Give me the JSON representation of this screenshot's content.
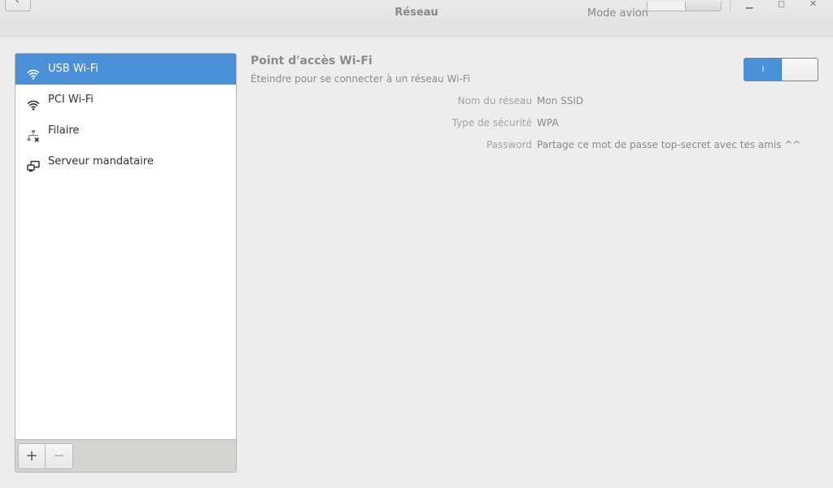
{
  "window": {
    "title": "Réseau",
    "mode_label": "Mode avion",
    "controls": {
      "minimize": "▁",
      "maximize": "◻",
      "close": "✕"
    }
  },
  "sidebar": {
    "items": [
      {
        "label": "USB Wi-Fi",
        "icon": "wifi-icon",
        "selected": true
      },
      {
        "label": "PCI Wi-Fi",
        "icon": "wifi-icon",
        "selected": false
      },
      {
        "label": "Filaire",
        "icon": "wired-network-icon",
        "selected": false
      },
      {
        "label": "Serveur mandataire",
        "icon": "proxy-icon",
        "selected": false
      }
    ],
    "toolbar": {
      "add_label": "+",
      "remove_label": "−"
    }
  },
  "hotspot": {
    "title": "Point d'accès Wi-Fi",
    "subtitle": "Éteindre pour se connecter à un réseau Wi-Fi",
    "toggle": {
      "on_label": "I",
      "state": "on"
    },
    "details": [
      {
        "key": "Nom du réseau",
        "value": "Mon SSID"
      },
      {
        "key": "Type de sécurité",
        "value": "WPA"
      },
      {
        "key": "Password",
        "value": "Partage ce mot de passe top-secret avec tes amis ^^"
      }
    ]
  },
  "colors": {
    "accent": "#4a90d9",
    "background": "#ededed",
    "muted_text": "#8a8a8a"
  }
}
